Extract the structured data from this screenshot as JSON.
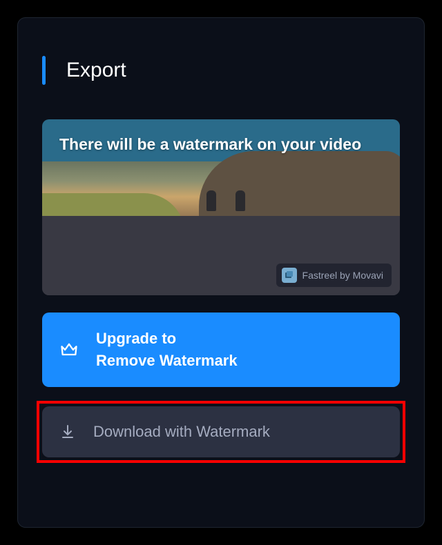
{
  "header": {
    "title": "Export"
  },
  "preview": {
    "overlay_text": "There will be a watermark on your video",
    "badge_text": "Fastreel by Movavi"
  },
  "buttons": {
    "upgrade": {
      "line1": "Upgrade to",
      "line2": "Remove Watermark"
    },
    "download": {
      "label": "Download with Watermark"
    }
  },
  "colors": {
    "accent": "#1a8cff",
    "panel_bg": "#0b0f19",
    "secondary_btn": "#2c3142",
    "highlight_border": "#ff0000"
  }
}
